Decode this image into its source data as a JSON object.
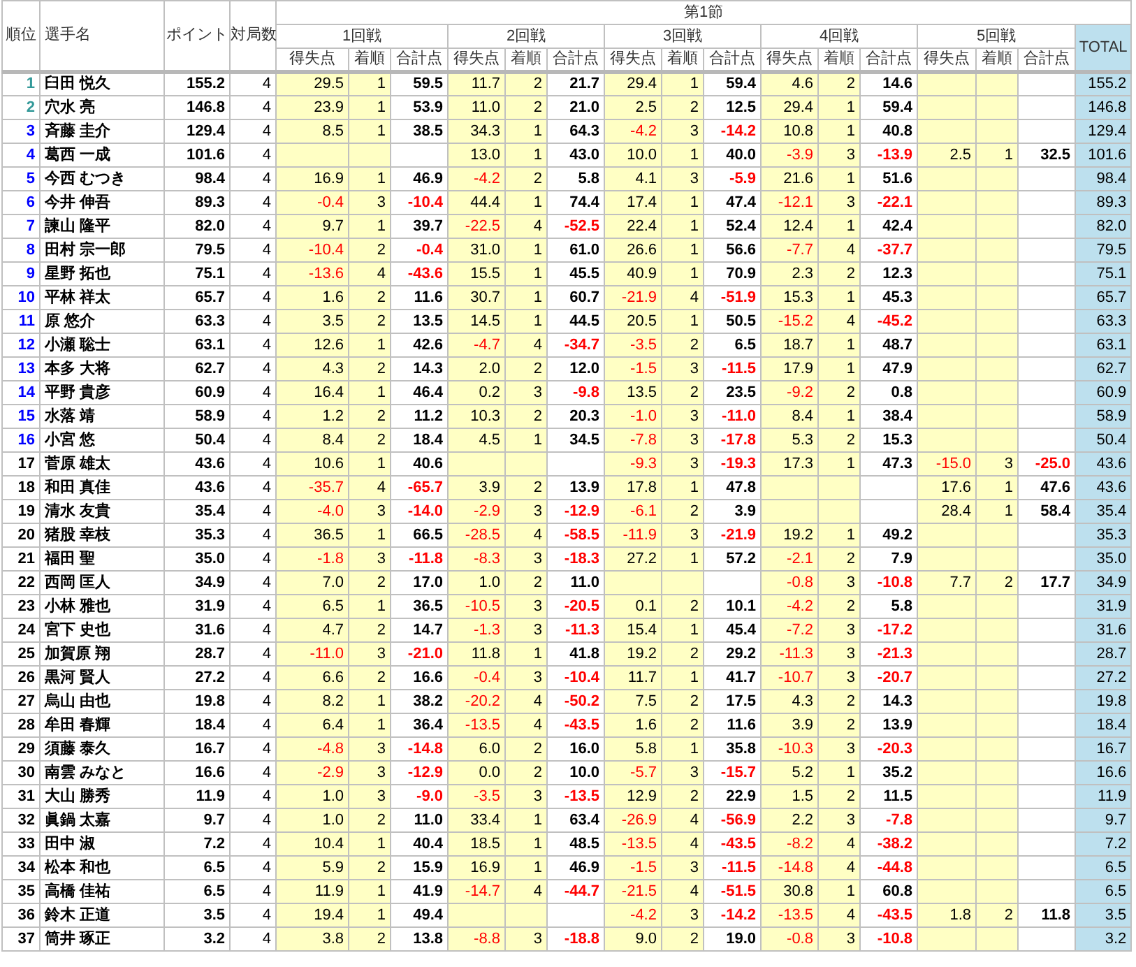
{
  "header": {
    "rank": "順位",
    "name": "選手名",
    "points": "ポイント",
    "games": "対局数",
    "section": "第1節",
    "total": "TOTAL",
    "rounds": [
      {
        "label": "1回戦",
        "columns": [
          "得失点",
          "着順",
          "合計点"
        ]
      },
      {
        "label": "2回戦",
        "columns": [
          "得失点",
          "着順",
          "合計点"
        ]
      },
      {
        "label": "3回戦",
        "columns": [
          "得失点",
          "着順",
          "合計点"
        ]
      },
      {
        "label": "4回戦",
        "columns": [
          "得失点",
          "着順",
          "合計点"
        ]
      },
      {
        "label": "5回戦",
        "columns": [
          "得失点",
          "着順",
          "合計点"
        ]
      }
    ]
  },
  "rows": [
    {
      "rank": "1",
      "color": "#339999",
      "name": "臼田 悦久",
      "points": "155.2",
      "games": "4",
      "rounds": {
        "1": [
          "29.5",
          "1",
          "59.5"
        ],
        "2": [
          "11.7",
          "2",
          "21.7"
        ],
        "3": [
          "29.4",
          "1",
          "59.4"
        ],
        "4": [
          "4.6",
          "2",
          "14.6"
        ]
      },
      "total": "155.2"
    },
    {
      "rank": "2",
      "color": "#339999",
      "name": "穴水 亮",
      "points": "146.8",
      "games": "4",
      "rounds": {
        "1": [
          "23.9",
          "1",
          "53.9"
        ],
        "2": [
          "11.0",
          "2",
          "21.0"
        ],
        "3": [
          "2.5",
          "2",
          "12.5"
        ],
        "4": [
          "29.4",
          "1",
          "59.4"
        ]
      },
      "total": "146.8"
    },
    {
      "rank": "3",
      "color": "#0000ff",
      "name": "斉藤 圭介",
      "points": "129.4",
      "games": "4",
      "rounds": {
        "1": [
          "8.5",
          "1",
          "38.5"
        ],
        "2": [
          "34.3",
          "1",
          "64.3"
        ],
        "3": [
          "-4.2",
          "3",
          "-14.2"
        ],
        "4": [
          "10.8",
          "1",
          "40.8"
        ]
      },
      "total": "129.4"
    },
    {
      "rank": "4",
      "color": "#0000ff",
      "name": "葛西 一成",
      "points": "101.6",
      "games": "4",
      "rounds": {
        "2": [
          "13.0",
          "1",
          "43.0"
        ],
        "3": [
          "10.0",
          "1",
          "40.0"
        ],
        "4": [
          "-3.9",
          "3",
          "-13.9"
        ],
        "5": [
          "2.5",
          "1",
          "32.5"
        ]
      },
      "total": "101.6"
    },
    {
      "rank": "5",
      "color": "#0000ff",
      "name": "今西 むつき",
      "points": "98.4",
      "games": "4",
      "rounds": {
        "1": [
          "16.9",
          "1",
          "46.9"
        ],
        "2": [
          "-4.2",
          "2",
          "5.8"
        ],
        "3": [
          "4.1",
          "3",
          "-5.9"
        ],
        "4": [
          "21.6",
          "1",
          "51.6"
        ]
      },
      "total": "98.4"
    },
    {
      "rank": "6",
      "color": "#0000ff",
      "name": "今井 伸吾",
      "points": "89.3",
      "games": "4",
      "rounds": {
        "1": [
          "-0.4",
          "3",
          "-10.4"
        ],
        "2": [
          "44.4",
          "1",
          "74.4"
        ],
        "3": [
          "17.4",
          "1",
          "47.4"
        ],
        "4": [
          "-12.1",
          "3",
          "-22.1"
        ]
      },
      "total": "89.3"
    },
    {
      "rank": "7",
      "color": "#0000ff",
      "name": "諫山 隆平",
      "points": "82.0",
      "games": "4",
      "rounds": {
        "1": [
          "9.7",
          "1",
          "39.7"
        ],
        "2": [
          "-22.5",
          "4",
          "-52.5"
        ],
        "3": [
          "22.4",
          "1",
          "52.4"
        ],
        "4": [
          "12.4",
          "1",
          "42.4"
        ]
      },
      "total": "82.0"
    },
    {
      "rank": "8",
      "color": "#0000ff",
      "name": "田村 宗一郎",
      "points": "79.5",
      "games": "4",
      "rounds": {
        "1": [
          "-10.4",
          "2",
          "-0.4"
        ],
        "2": [
          "31.0",
          "1",
          "61.0"
        ],
        "3": [
          "26.6",
          "1",
          "56.6"
        ],
        "4": [
          "-7.7",
          "4",
          "-37.7"
        ]
      },
      "total": "79.5"
    },
    {
      "rank": "9",
      "color": "#0000ff",
      "name": "星野 拓也",
      "points": "75.1",
      "games": "4",
      "rounds": {
        "1": [
          "-13.6",
          "4",
          "-43.6"
        ],
        "2": [
          "15.5",
          "1",
          "45.5"
        ],
        "3": [
          "40.9",
          "1",
          "70.9"
        ],
        "4": [
          "2.3",
          "2",
          "12.3"
        ]
      },
      "total": "75.1"
    },
    {
      "rank": "10",
      "color": "#0000ff",
      "name": "平林 祥太",
      "points": "65.7",
      "games": "4",
      "rounds": {
        "1": [
          "1.6",
          "2",
          "11.6"
        ],
        "2": [
          "30.7",
          "1",
          "60.7"
        ],
        "3": [
          "-21.9",
          "4",
          "-51.9"
        ],
        "4": [
          "15.3",
          "1",
          "45.3"
        ]
      },
      "total": "65.7"
    },
    {
      "rank": "11",
      "color": "#0000ff",
      "name": "原 悠介",
      "points": "63.3",
      "games": "4",
      "rounds": {
        "1": [
          "3.5",
          "2",
          "13.5"
        ],
        "2": [
          "14.5",
          "1",
          "44.5"
        ],
        "3": [
          "20.5",
          "1",
          "50.5"
        ],
        "4": [
          "-15.2",
          "4",
          "-45.2"
        ]
      },
      "total": "63.3"
    },
    {
      "rank": "12",
      "color": "#0000ff",
      "name": "小瀬 聡士",
      "points": "63.1",
      "games": "4",
      "rounds": {
        "1": [
          "12.6",
          "1",
          "42.6"
        ],
        "2": [
          "-4.7",
          "4",
          "-34.7"
        ],
        "3": [
          "-3.5",
          "2",
          "6.5"
        ],
        "4": [
          "18.7",
          "1",
          "48.7"
        ]
      },
      "total": "63.1"
    },
    {
      "rank": "13",
      "color": "#0000ff",
      "name": "本多 大将",
      "points": "62.7",
      "games": "4",
      "rounds": {
        "1": [
          "4.3",
          "2",
          "14.3"
        ],
        "2": [
          "2.0",
          "2",
          "12.0"
        ],
        "3": [
          "-1.5",
          "3",
          "-11.5"
        ],
        "4": [
          "17.9",
          "1",
          "47.9"
        ]
      },
      "total": "62.7"
    },
    {
      "rank": "14",
      "color": "#0000ff",
      "name": "平野 貴彦",
      "points": "60.9",
      "games": "4",
      "rounds": {
        "1": [
          "16.4",
          "1",
          "46.4"
        ],
        "2": [
          "0.2",
          "3",
          "-9.8"
        ],
        "3": [
          "13.5",
          "2",
          "23.5"
        ],
        "4": [
          "-9.2",
          "2",
          "0.8"
        ]
      },
      "total": "60.9"
    },
    {
      "rank": "15",
      "color": "#0000ff",
      "name": "水落 靖",
      "points": "58.9",
      "games": "4",
      "rounds": {
        "1": [
          "1.2",
          "2",
          "11.2"
        ],
        "2": [
          "10.3",
          "2",
          "20.3"
        ],
        "3": [
          "-1.0",
          "3",
          "-11.0"
        ],
        "4": [
          "8.4",
          "1",
          "38.4"
        ]
      },
      "total": "58.9"
    },
    {
      "rank": "16",
      "color": "#0000ff",
      "name": "小宮 悠",
      "points": "50.4",
      "games": "4",
      "rounds": {
        "1": [
          "8.4",
          "2",
          "18.4"
        ],
        "2": [
          "4.5",
          "1",
          "34.5"
        ],
        "3": [
          "-7.8",
          "3",
          "-17.8"
        ],
        "4": [
          "5.3",
          "2",
          "15.3"
        ]
      },
      "total": "50.4"
    },
    {
      "rank": "17",
      "color": "#000000",
      "name": "菅原 雄太",
      "points": "43.6",
      "games": "4",
      "rounds": {
        "1": [
          "10.6",
          "1",
          "40.6"
        ],
        "3": [
          "-9.3",
          "3",
          "-19.3"
        ],
        "4": [
          "17.3",
          "1",
          "47.3"
        ],
        "5": [
          "-15.0",
          "3",
          "-25.0"
        ]
      },
      "total": "43.6"
    },
    {
      "rank": "18",
      "color": "#000000",
      "name": "和田 真佳",
      "points": "43.6",
      "games": "4",
      "rounds": {
        "1": [
          "-35.7",
          "4",
          "-65.7"
        ],
        "2": [
          "3.9",
          "2",
          "13.9"
        ],
        "3": [
          "17.8",
          "1",
          "47.8"
        ],
        "5": [
          "17.6",
          "1",
          "47.6"
        ]
      },
      "total": "43.6"
    },
    {
      "rank": "19",
      "color": "#000000",
      "name": "清水 友貴",
      "points": "35.4",
      "games": "4",
      "rounds": {
        "1": [
          "-4.0",
          "3",
          "-14.0"
        ],
        "2": [
          "-2.9",
          "3",
          "-12.9"
        ],
        "3": [
          "-6.1",
          "2",
          "3.9"
        ],
        "5": [
          "28.4",
          "1",
          "58.4"
        ]
      },
      "total": "35.4"
    },
    {
      "rank": "20",
      "color": "#000000",
      "name": "猪股 幸枝",
      "points": "35.3",
      "games": "4",
      "rounds": {
        "1": [
          "36.5",
          "1",
          "66.5"
        ],
        "2": [
          "-28.5",
          "4",
          "-58.5"
        ],
        "3": [
          "-11.9",
          "3",
          "-21.9"
        ],
        "4": [
          "19.2",
          "1",
          "49.2"
        ]
      },
      "total": "35.3"
    },
    {
      "rank": "21",
      "color": "#000000",
      "name": "福田 聖",
      "points": "35.0",
      "games": "4",
      "rounds": {
        "1": [
          "-1.8",
          "3",
          "-11.8"
        ],
        "2": [
          "-8.3",
          "3",
          "-18.3"
        ],
        "3": [
          "27.2",
          "1",
          "57.2"
        ],
        "4": [
          "-2.1",
          "2",
          "7.9"
        ]
      },
      "total": "35.0"
    },
    {
      "rank": "22",
      "color": "#000000",
      "name": "西岡 匡人",
      "points": "34.9",
      "games": "4",
      "rounds": {
        "1": [
          "7.0",
          "2",
          "17.0"
        ],
        "2": [
          "1.0",
          "2",
          "11.0"
        ],
        "4": [
          "-0.8",
          "3",
          "-10.8"
        ],
        "5": [
          "7.7",
          "2",
          "17.7"
        ]
      },
      "total": "34.9"
    },
    {
      "rank": "23",
      "color": "#000000",
      "name": "小林 雅也",
      "points": "31.9",
      "games": "4",
      "rounds": {
        "1": [
          "6.5",
          "1",
          "36.5"
        ],
        "2": [
          "-10.5",
          "3",
          "-20.5"
        ],
        "3": [
          "0.1",
          "2",
          "10.1"
        ],
        "4": [
          "-4.2",
          "2",
          "5.8"
        ]
      },
      "total": "31.9"
    },
    {
      "rank": "24",
      "color": "#000000",
      "name": "宮下 史也",
      "points": "31.6",
      "games": "4",
      "rounds": {
        "1": [
          "4.7",
          "2",
          "14.7"
        ],
        "2": [
          "-1.3",
          "3",
          "-11.3"
        ],
        "3": [
          "15.4",
          "1",
          "45.4"
        ],
        "4": [
          "-7.2",
          "3",
          "-17.2"
        ]
      },
      "total": "31.6"
    },
    {
      "rank": "25",
      "color": "#000000",
      "name": "加賀原 翔",
      "points": "28.7",
      "games": "4",
      "rounds": {
        "1": [
          "-11.0",
          "3",
          "-21.0"
        ],
        "2": [
          "11.8",
          "1",
          "41.8"
        ],
        "3": [
          "19.2",
          "2",
          "29.2"
        ],
        "4": [
          "-11.3",
          "3",
          "-21.3"
        ]
      },
      "total": "28.7"
    },
    {
      "rank": "26",
      "color": "#000000",
      "name": "黒河 賢人",
      "points": "27.2",
      "games": "4",
      "rounds": {
        "1": [
          "6.6",
          "2",
          "16.6"
        ],
        "2": [
          "-0.4",
          "3",
          "-10.4"
        ],
        "3": [
          "11.7",
          "1",
          "41.7"
        ],
        "4": [
          "-10.7",
          "3",
          "-20.7"
        ]
      },
      "total": "27.2"
    },
    {
      "rank": "27",
      "color": "#000000",
      "name": "烏山 由也",
      "points": "19.8",
      "games": "4",
      "rounds": {
        "1": [
          "8.2",
          "1",
          "38.2"
        ],
        "2": [
          "-20.2",
          "4",
          "-50.2"
        ],
        "3": [
          "7.5",
          "2",
          "17.5"
        ],
        "4": [
          "4.3",
          "2",
          "14.3"
        ]
      },
      "total": "19.8"
    },
    {
      "rank": "28",
      "color": "#000000",
      "name": "牟田 春輝",
      "points": "18.4",
      "games": "4",
      "rounds": {
        "1": [
          "6.4",
          "1",
          "36.4"
        ],
        "2": [
          "-13.5",
          "4",
          "-43.5"
        ],
        "3": [
          "1.6",
          "2",
          "11.6"
        ],
        "4": [
          "3.9",
          "2",
          "13.9"
        ]
      },
      "total": "18.4"
    },
    {
      "rank": "29",
      "color": "#000000",
      "name": "須藤 泰久",
      "points": "16.7",
      "games": "4",
      "rounds": {
        "1": [
          "-4.8",
          "3",
          "-14.8"
        ],
        "2": [
          "6.0",
          "2",
          "16.0"
        ],
        "3": [
          "5.8",
          "1",
          "35.8"
        ],
        "4": [
          "-10.3",
          "3",
          "-20.3"
        ]
      },
      "total": "16.7"
    },
    {
      "rank": "30",
      "color": "#000000",
      "name": "南雲 みなと",
      "points": "16.6",
      "games": "4",
      "rounds": {
        "1": [
          "-2.9",
          "3",
          "-12.9"
        ],
        "2": [
          "0.0",
          "2",
          "10.0"
        ],
        "3": [
          "-5.7",
          "3",
          "-15.7"
        ],
        "4": [
          "5.2",
          "1",
          "35.2"
        ]
      },
      "total": "16.6"
    },
    {
      "rank": "31",
      "color": "#000000",
      "name": "大山 勝秀",
      "points": "11.9",
      "games": "4",
      "rounds": {
        "1": [
          "1.0",
          "3",
          "-9.0"
        ],
        "2": [
          "-3.5",
          "3",
          "-13.5"
        ],
        "3": [
          "12.9",
          "2",
          "22.9"
        ],
        "4": [
          "1.5",
          "2",
          "11.5"
        ]
      },
      "total": "11.9"
    },
    {
      "rank": "32",
      "color": "#000000",
      "name": "眞鍋 太嘉",
      "points": "9.7",
      "games": "4",
      "rounds": {
        "1": [
          "1.0",
          "2",
          "11.0"
        ],
        "2": [
          "33.4",
          "1",
          "63.4"
        ],
        "3": [
          "-26.9",
          "4",
          "-56.9"
        ],
        "4": [
          "2.2",
          "3",
          "-7.8"
        ]
      },
      "total": "9.7"
    },
    {
      "rank": "33",
      "color": "#000000",
      "name": "田中 淑",
      "points": "7.2",
      "games": "4",
      "rounds": {
        "1": [
          "10.4",
          "1",
          "40.4"
        ],
        "2": [
          "18.5",
          "1",
          "48.5"
        ],
        "3": [
          "-13.5",
          "4",
          "-43.5"
        ],
        "4": [
          "-8.2",
          "4",
          "-38.2"
        ]
      },
      "total": "7.2"
    },
    {
      "rank": "34",
      "color": "#000000",
      "name": "松本 和也",
      "points": "6.5",
      "games": "4",
      "rounds": {
        "1": [
          "5.9",
          "2",
          "15.9"
        ],
        "2": [
          "16.9",
          "1",
          "46.9"
        ],
        "3": [
          "-1.5",
          "3",
          "-11.5"
        ],
        "4": [
          "-14.8",
          "4",
          "-44.8"
        ]
      },
      "total": "6.5"
    },
    {
      "rank": "35",
      "color": "#000000",
      "name": "高橋 佳祐",
      "points": "6.5",
      "games": "4",
      "rounds": {
        "1": [
          "11.9",
          "1",
          "41.9"
        ],
        "2": [
          "-14.7",
          "4",
          "-44.7"
        ],
        "3": [
          "-21.5",
          "4",
          "-51.5"
        ],
        "4": [
          "30.8",
          "1",
          "60.8"
        ]
      },
      "total": "6.5"
    },
    {
      "rank": "36",
      "color": "#000000",
      "name": "鈴木 正道",
      "points": "3.5",
      "games": "4",
      "rounds": {
        "1": [
          "19.4",
          "1",
          "49.4"
        ],
        "3": [
          "-4.2",
          "3",
          "-14.2"
        ],
        "4": [
          "-13.5",
          "4",
          "-43.5"
        ],
        "5": [
          "1.8",
          "2",
          "11.8"
        ]
      },
      "total": "3.5"
    },
    {
      "rank": "37",
      "color": "#000000",
      "name": "筒井 琢正",
      "points": "3.2",
      "games": "4",
      "rounds": {
        "1": [
          "3.8",
          "2",
          "13.8"
        ],
        "2": [
          "-8.8",
          "3",
          "-18.8"
        ],
        "3": [
          "9.0",
          "2",
          "19.0"
        ],
        "4": [
          "-0.8",
          "3",
          "-10.8"
        ]
      },
      "total": "3.2"
    }
  ]
}
